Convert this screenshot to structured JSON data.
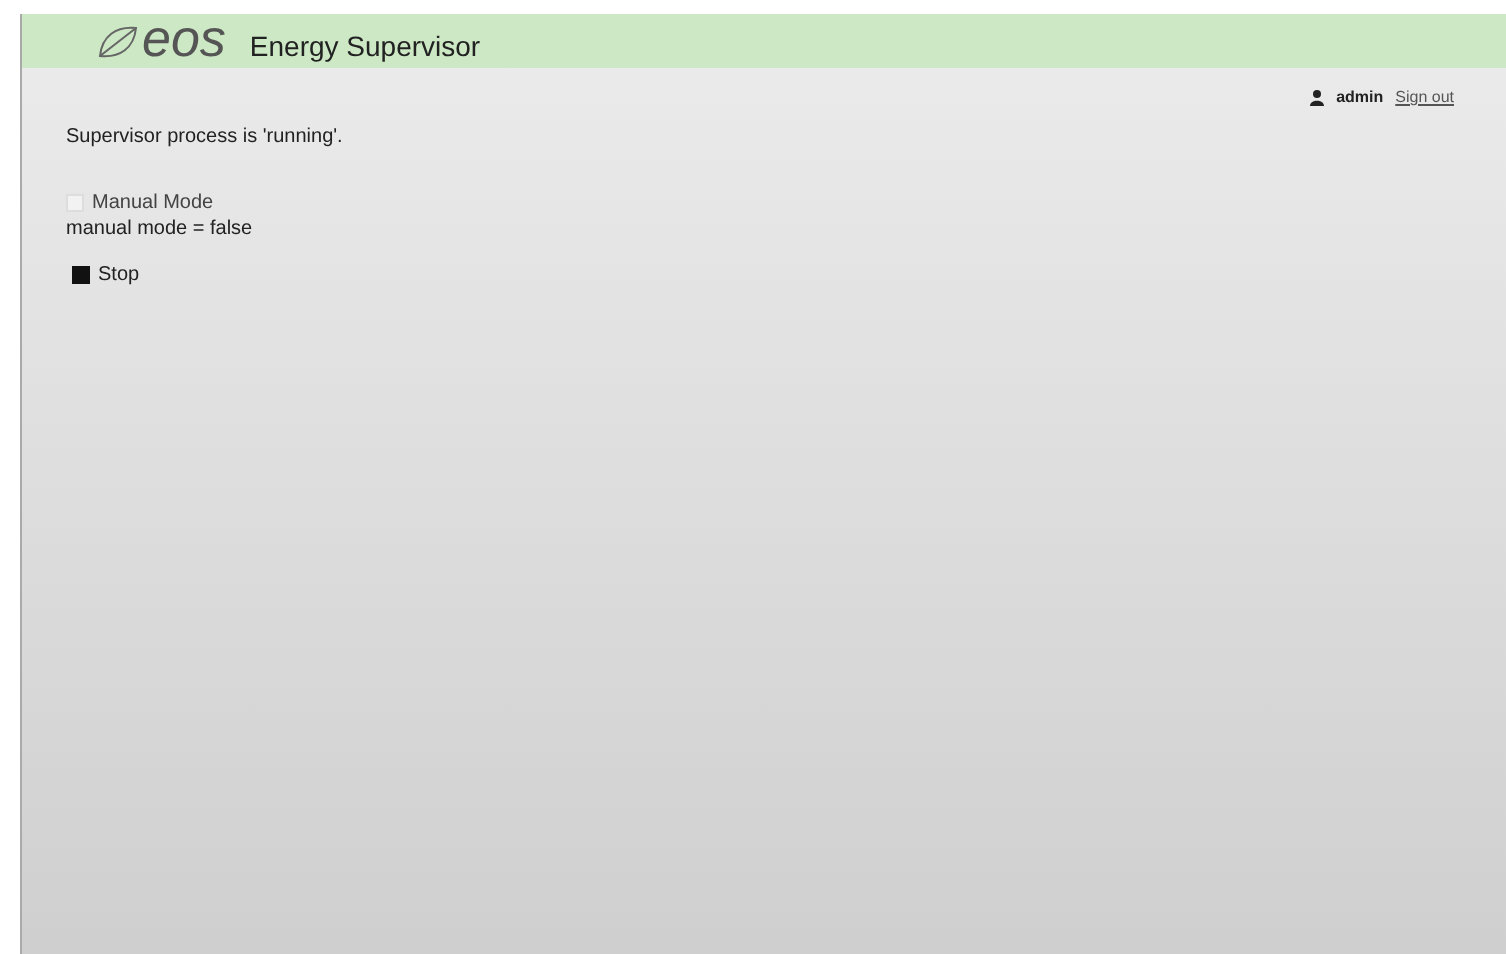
{
  "header": {
    "logo": "eos",
    "title": "Energy Supervisor"
  },
  "user": {
    "name": "admin",
    "sign_out": "Sign out"
  },
  "status": "Supervisor process is 'running'.",
  "manual_mode": {
    "label": "Manual Mode",
    "checked": false,
    "disabled": true,
    "readout": "manual mode = false"
  },
  "stop_button": {
    "label": "Stop"
  }
}
